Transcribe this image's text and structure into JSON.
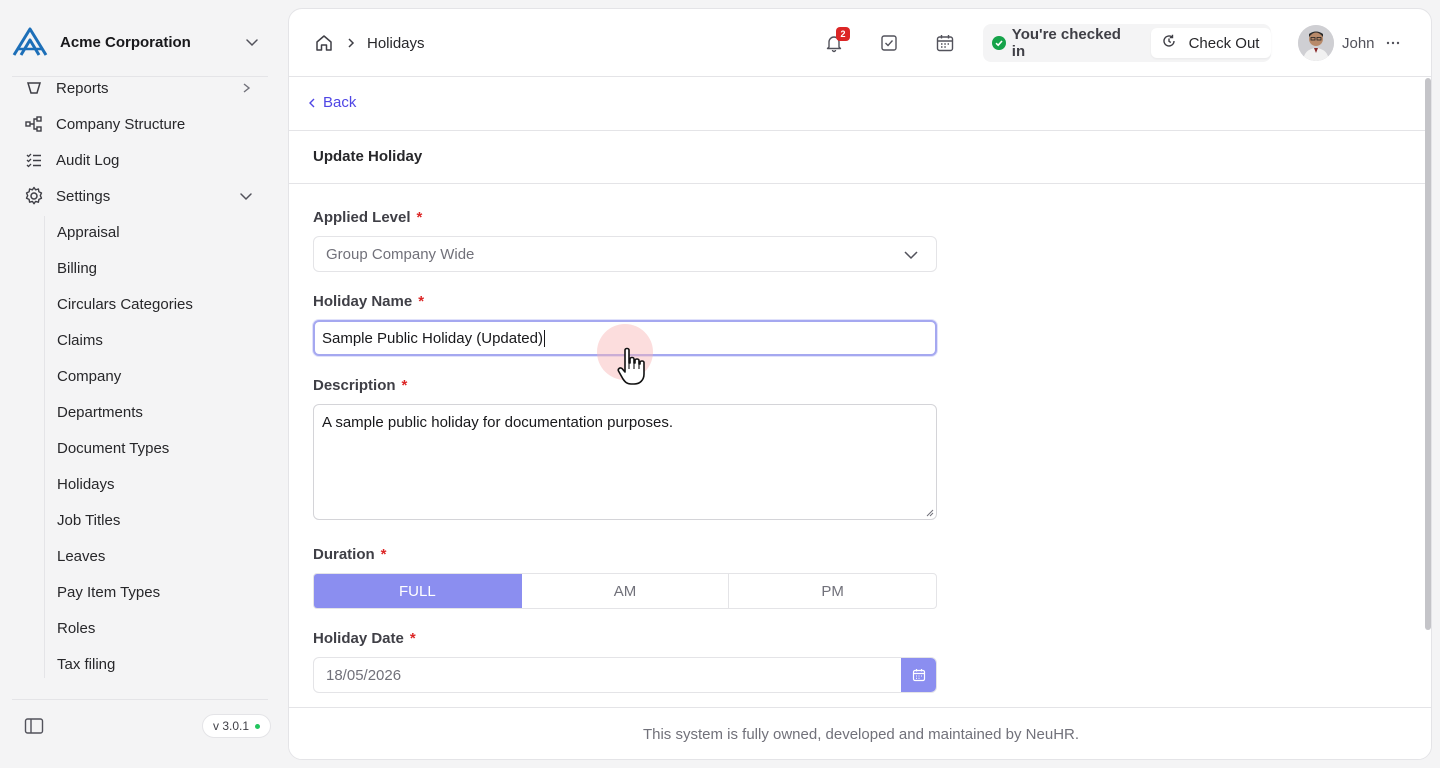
{
  "organization": {
    "name": "Acme Corporation"
  },
  "sidebar": {
    "items": [
      {
        "label": "Reports",
        "icon": "reports-icon"
      },
      {
        "label": "Company Structure",
        "icon": "hierarchy-icon"
      },
      {
        "label": "Audit Log",
        "icon": "checklist-icon"
      },
      {
        "label": "Settings",
        "icon": "gear-icon"
      }
    ],
    "settings_subitems": [
      "Appraisal",
      "Billing",
      "Circulars Categories",
      "Claims",
      "Company",
      "Departments",
      "Document Types",
      "Holidays",
      "Job Titles",
      "Leaves",
      "Pay Item Types",
      "Roles",
      "Tax filing"
    ],
    "version": "v 3.0.1"
  },
  "topbar": {
    "breadcrumb": {
      "current": "Holidays"
    },
    "notifications_count": "2",
    "checkin_status": "You're checked in",
    "checkout_label": "Check Out",
    "user_name": "John"
  },
  "page": {
    "back_label": "Back",
    "title": "Update Holiday"
  },
  "form": {
    "applied_level": {
      "label": "Applied Level",
      "value": "Group Company Wide"
    },
    "holiday_name": {
      "label": "Holiday Name",
      "value": "Sample Public Holiday (Updated)"
    },
    "description": {
      "label": "Description",
      "value": "A sample public holiday for documentation purposes."
    },
    "duration": {
      "label": "Duration",
      "options": [
        "FULL",
        "AM",
        "PM"
      ],
      "selected": "FULL"
    },
    "holiday_date": {
      "label": "Holiday Date",
      "value": "18/05/2026"
    },
    "required_mark": "*"
  },
  "footer": {
    "text": "This system is fully owned, developed and maintained by NeuHR."
  },
  "colors": {
    "accent": "#8b8ef0",
    "link": "#4f46e5",
    "logo_blue": "#1d6fb8",
    "success": "#16a34a",
    "badge": "#dc2626"
  }
}
